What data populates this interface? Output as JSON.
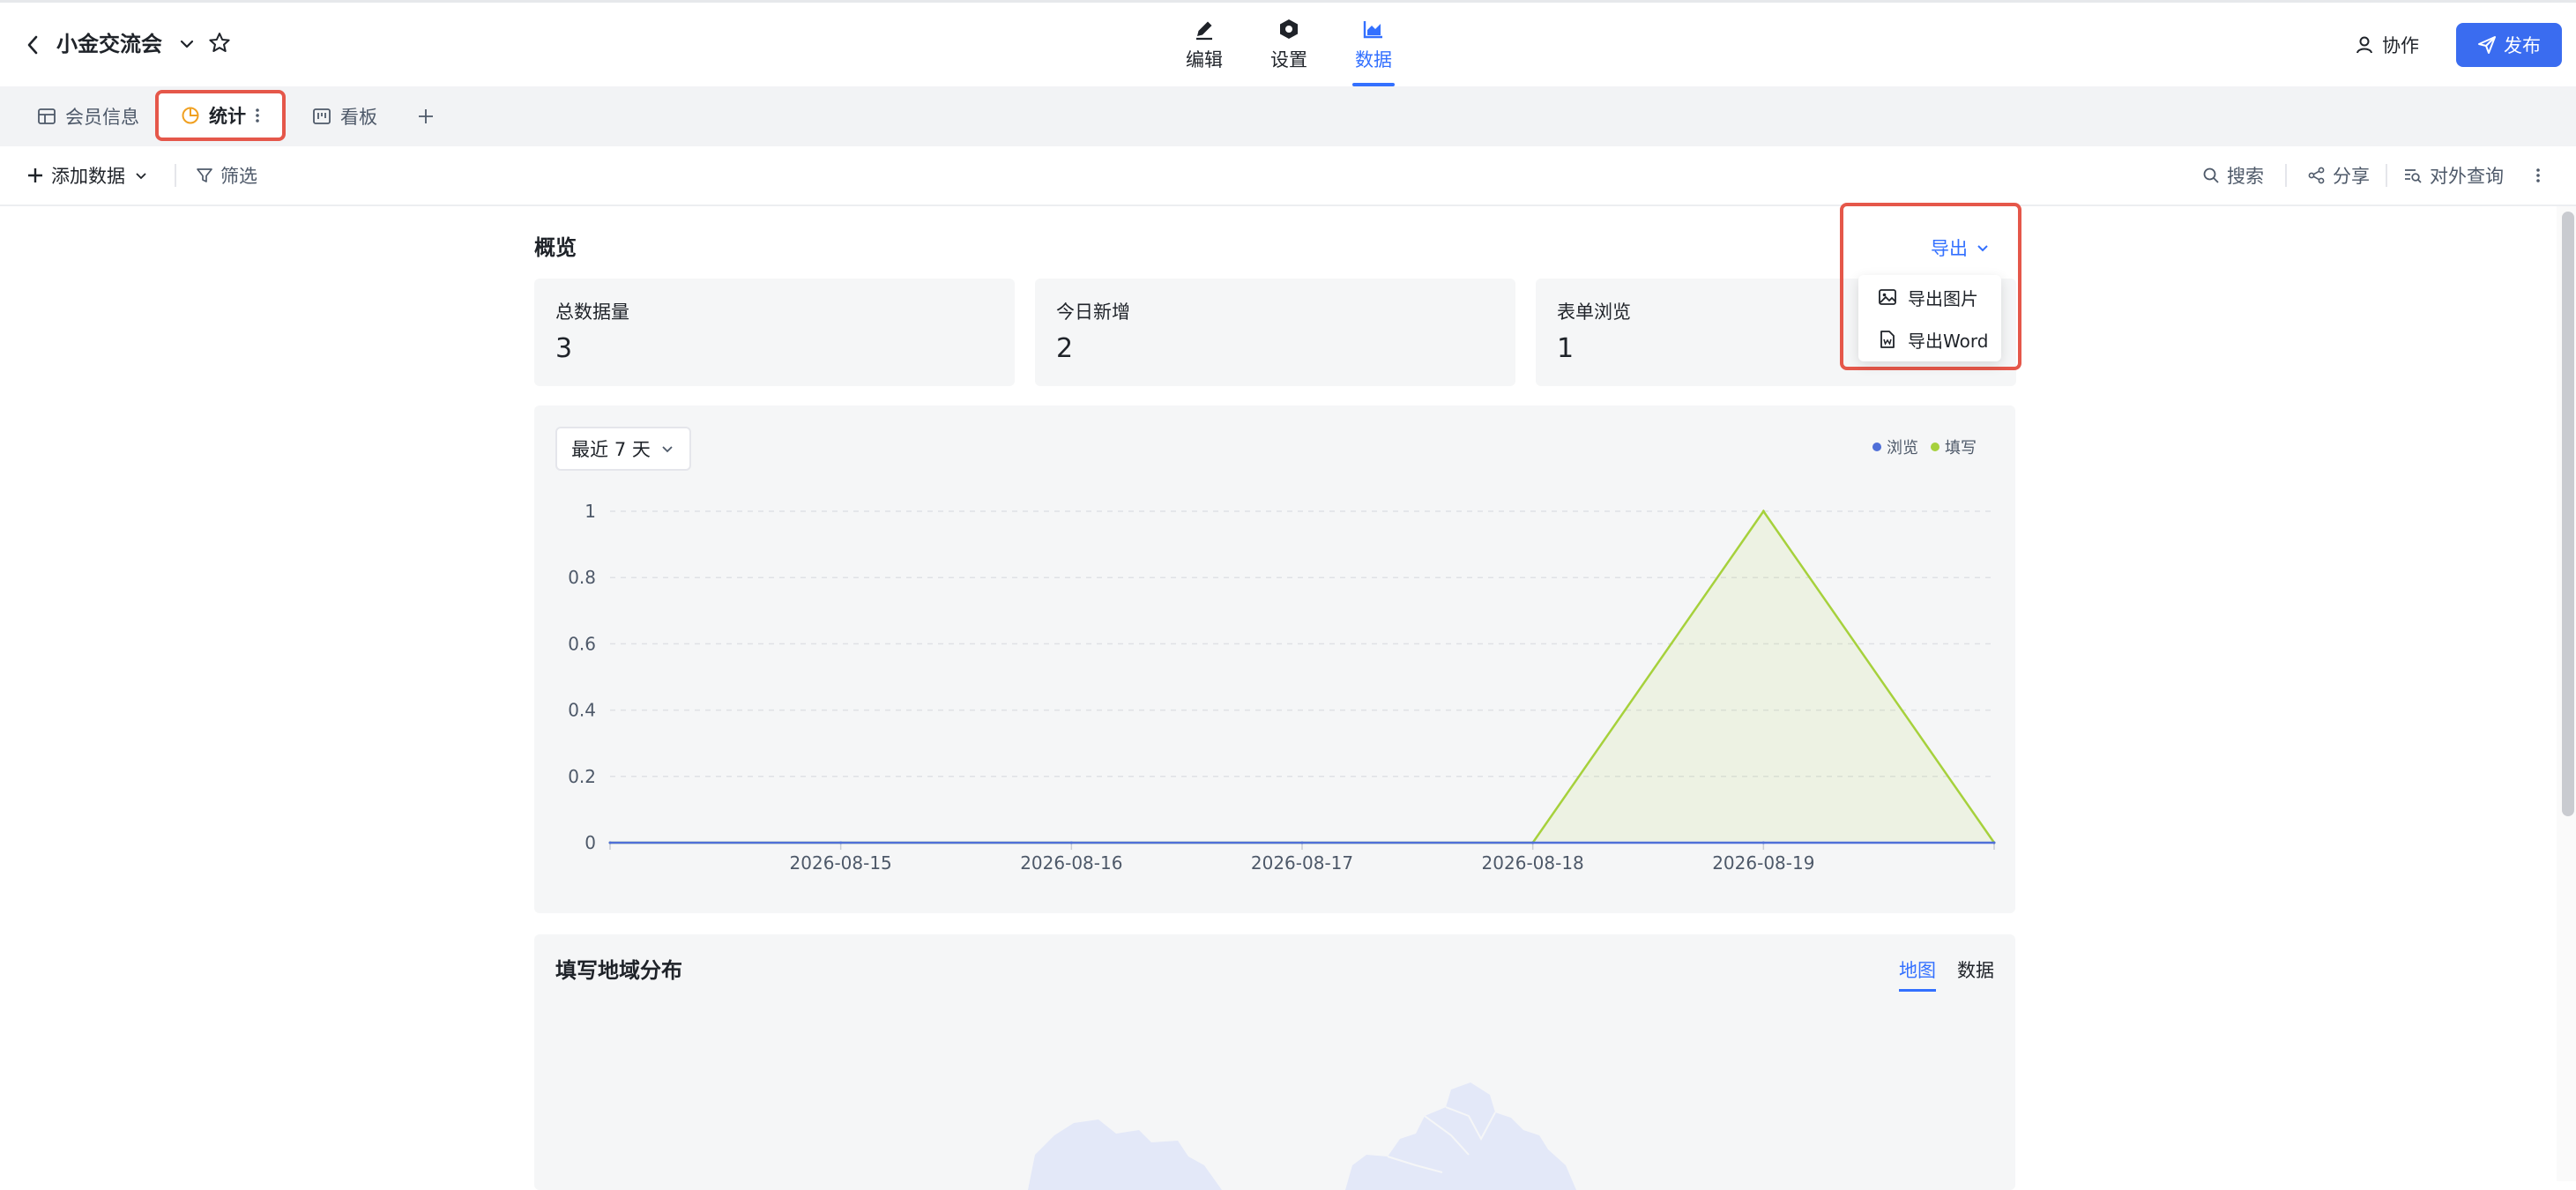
{
  "header": {
    "title": "小金交流会",
    "nav": [
      {
        "label": "编辑",
        "icon": "pencil-icon"
      },
      {
        "label": "设置",
        "icon": "hexagon-settings-icon"
      },
      {
        "label": "数据",
        "icon": "area-chart-icon"
      }
    ],
    "active_nav": "数据",
    "collab_label": "协作",
    "publish_label": "发布"
  },
  "view_tabs": [
    {
      "label": "会员信息",
      "icon": "table-icon"
    },
    {
      "label": "统计",
      "icon": "pie-chart-icon",
      "active": true
    },
    {
      "label": "看板",
      "icon": "kanban-icon"
    }
  ],
  "toolbar": {
    "add_data": "添加数据",
    "filter": "筛选",
    "search": "搜索",
    "share": "分享",
    "external_query": "对外查询"
  },
  "overview": {
    "title": "概览",
    "stats": [
      {
        "label": "总数据量",
        "value": "3"
      },
      {
        "label": "今日新增",
        "value": "2"
      },
      {
        "label": "表单浏览",
        "value": "1"
      }
    ],
    "export": {
      "label": "导出",
      "menu": [
        {
          "label": "导出图片",
          "icon": "image-icon"
        },
        {
          "label": "导出Word",
          "icon": "word-file-icon"
        }
      ]
    }
  },
  "trend": {
    "range_label": "最近 7 天",
    "legend": [
      {
        "name": "浏览",
        "color": "#4f6fd8"
      },
      {
        "name": "填写",
        "color": "#a6d13c"
      }
    ]
  },
  "chart_data": {
    "type": "area",
    "x": [
      "",
      "2026-08-15",
      "2026-08-16",
      "2026-08-17",
      "2026-08-18",
      "2026-08-19",
      ""
    ],
    "series": [
      {
        "name": "浏览",
        "values": [
          0,
          0,
          0,
          0,
          0,
          0,
          0
        ],
        "color": "#4f6fd8"
      },
      {
        "name": "填写",
        "values": [
          0,
          0,
          0,
          0,
          0,
          1,
          0
        ],
        "color": "#a6d13c"
      }
    ],
    "yticks": [
      "0",
      "0.2",
      "0.4",
      "0.6",
      "0.8",
      "1"
    ],
    "ylim": [
      0,
      1
    ],
    "grid": true,
    "legend_position": "top-right"
  },
  "map_section": {
    "title": "填写地域分布",
    "tabs": [
      "地图",
      "数据"
    ],
    "active_tab": "地图"
  },
  "colors": {
    "accent": "#3370ff",
    "publish_bg": "#3a6cf0",
    "highlight_border": "#e5574a"
  }
}
